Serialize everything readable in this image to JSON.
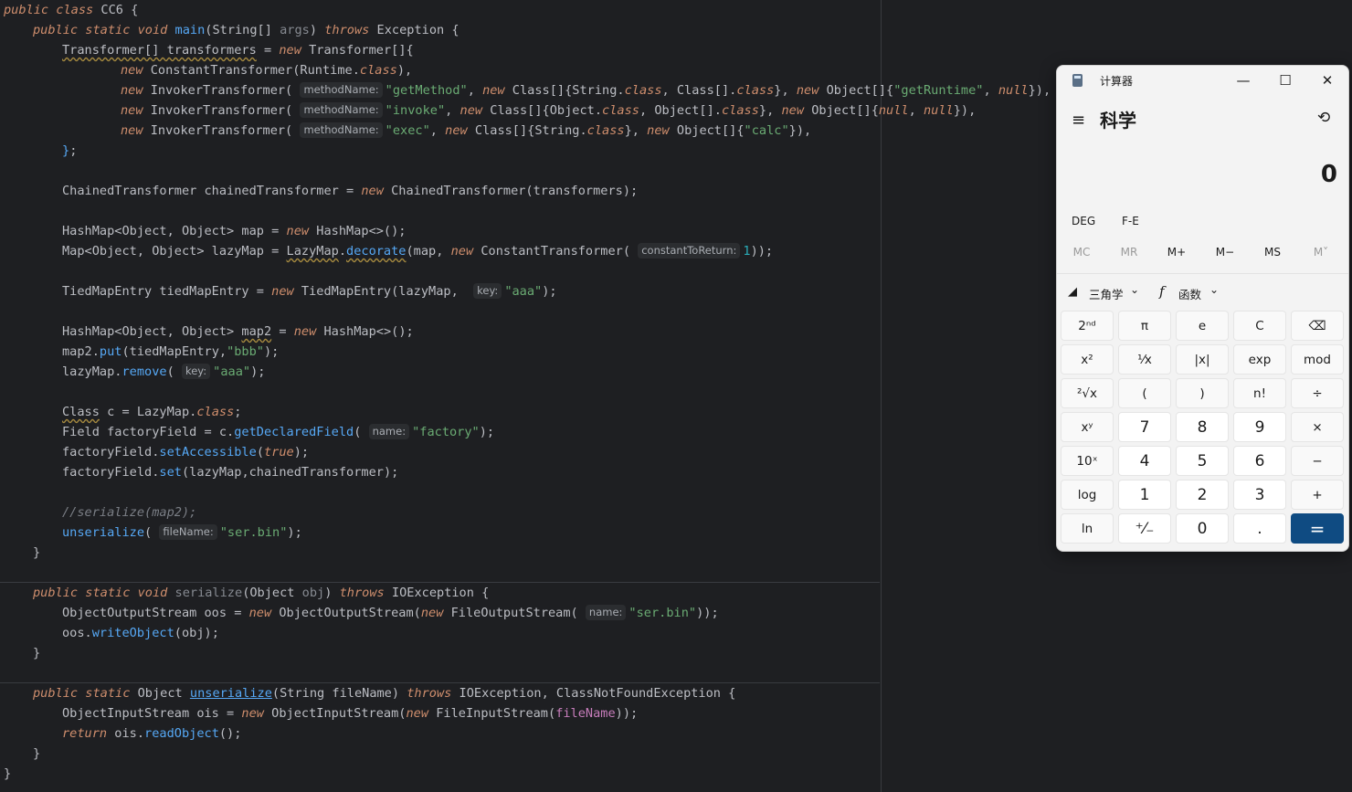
{
  "editor": {
    "lines": {
      "l1": [
        "public class CC6 {"
      ],
      "hint_methodName": "methodName:",
      "hint_constantToReturn": "constantToReturn:",
      "hint_key": "key:",
      "hint_name": "name:",
      "hint_fileName": "fileName:"
    }
  },
  "calculator": {
    "title": "计算器",
    "mode": "科学",
    "display": "0",
    "angle": "DEG",
    "fe": "F-E",
    "memory": [
      "MC",
      "MR",
      "M+",
      "M−",
      "MS",
      "M˅"
    ],
    "trig_label": "三角学",
    "func_label": "函数",
    "keys": [
      [
        "2ⁿᵈ",
        "π",
        "e",
        "C",
        "⌫"
      ],
      [
        "x²",
        "¹⁄x",
        "|x|",
        "exp",
        "mod"
      ],
      [
        "²√x",
        "(",
        ")",
        "n!",
        "÷"
      ],
      [
        "xʸ",
        "7",
        "8",
        "9",
        "×"
      ],
      [
        "10ˣ",
        "4",
        "5",
        "6",
        "−"
      ],
      [
        "log",
        "1",
        "2",
        "3",
        "+"
      ],
      [
        "ln",
        "⁺⁄₋",
        "0",
        ".",
        "="
      ]
    ]
  }
}
